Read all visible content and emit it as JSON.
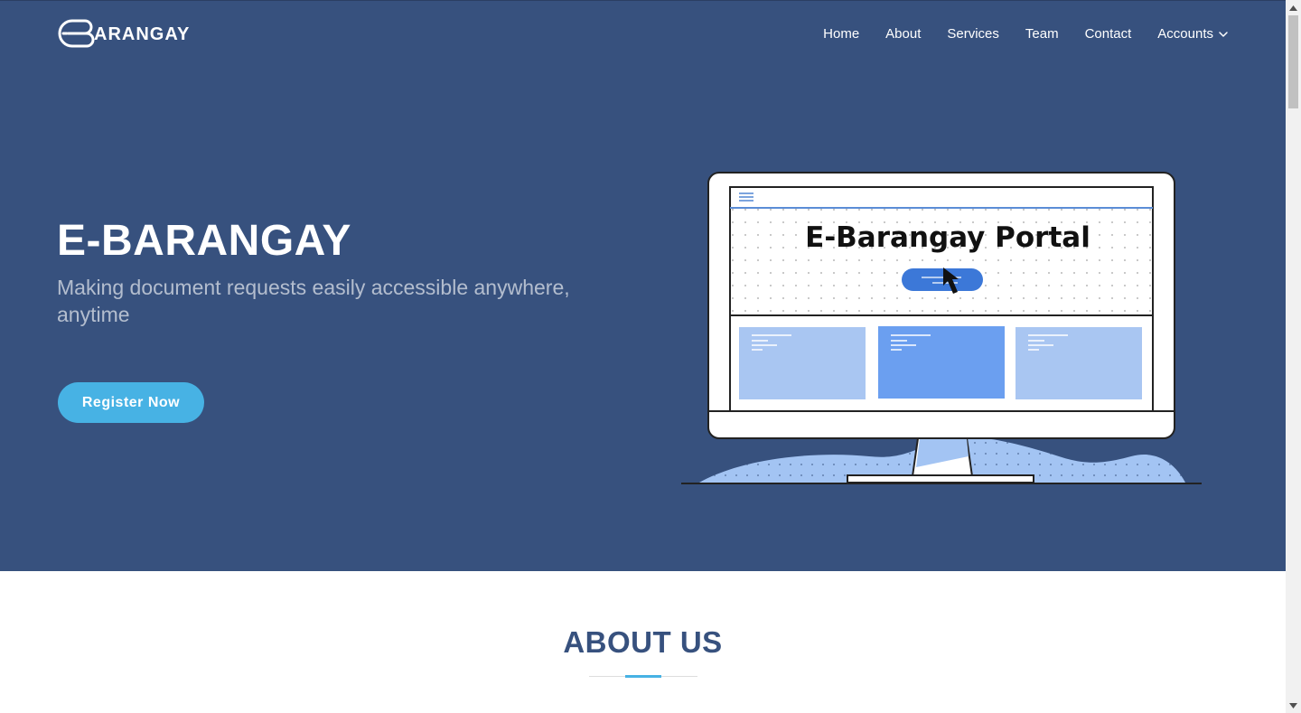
{
  "brand": {
    "logo_text": "BARANGAY"
  },
  "nav": {
    "items": [
      {
        "label": "Home"
      },
      {
        "label": "About"
      },
      {
        "label": "Services"
      },
      {
        "label": "Team"
      },
      {
        "label": "Contact"
      },
      {
        "label": "Accounts"
      }
    ]
  },
  "hero": {
    "title": "E-BARANGAY",
    "subtitle": "Making document requests easily accessible anywhere, anytime",
    "cta_label": "Register Now",
    "illustration_caption": "E-Barangay Portal"
  },
  "about": {
    "title": "ABOUT US"
  },
  "colors": {
    "hero_bg": "#37517e",
    "accent": "#47b2e4",
    "heading": "#37517e"
  },
  "icons": {
    "dropdown": "chevron-down-icon",
    "menu": "hamburger-icon",
    "cursor": "cursor-arrow-icon"
  }
}
